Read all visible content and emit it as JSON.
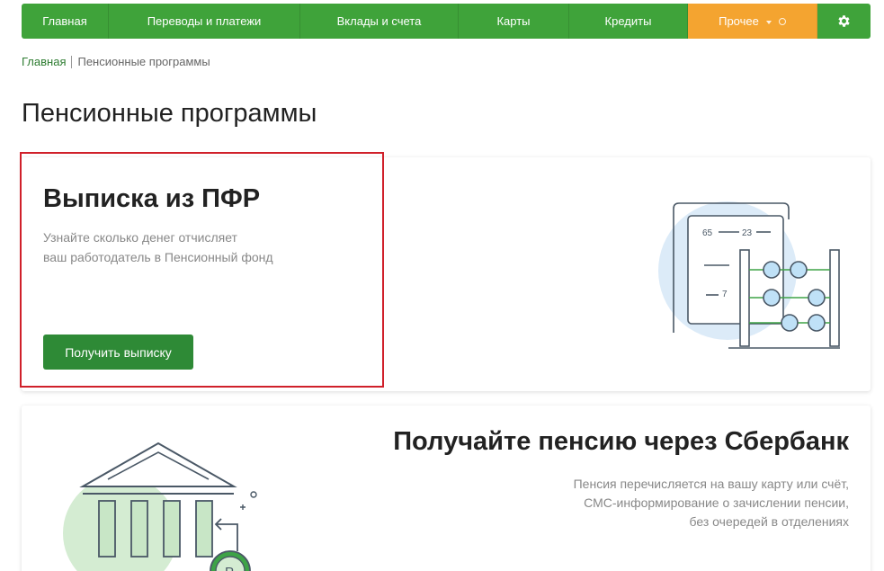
{
  "nav": {
    "items": [
      {
        "label": "Главная"
      },
      {
        "label": "Переводы и платежи"
      },
      {
        "label": "Вклады и счета"
      },
      {
        "label": "Карты"
      },
      {
        "label": "Кредиты"
      }
    ],
    "more_label": "Прочее",
    "settings_icon": "gear-icon",
    "colors": {
      "green": "#3fa33a",
      "orange": "#f4a430"
    }
  },
  "breadcrumb": {
    "home": "Главная",
    "current": "Пенсионные программы"
  },
  "page_title": "Пенсионные программы",
  "pfr_card": {
    "title": "Выписка из ПФР",
    "desc_line1": "Узнайте сколько денег отчисляет",
    "desc_line2": "ваш работодатель в Пенсионный фонд",
    "button": "Получить выписку",
    "illustration": {
      "num_a": "65",
      "num_b": "23",
      "num_c": "7"
    }
  },
  "pension_card": {
    "title": "Получайте пенсию через Сбербанк",
    "desc_lines": [
      "Пенсия перечисляется на вашу карту или счёт,",
      "СМС-информирование о зачислении пенсии,",
      "без очередей в отделениях"
    ],
    "coin_letter": "Р"
  }
}
